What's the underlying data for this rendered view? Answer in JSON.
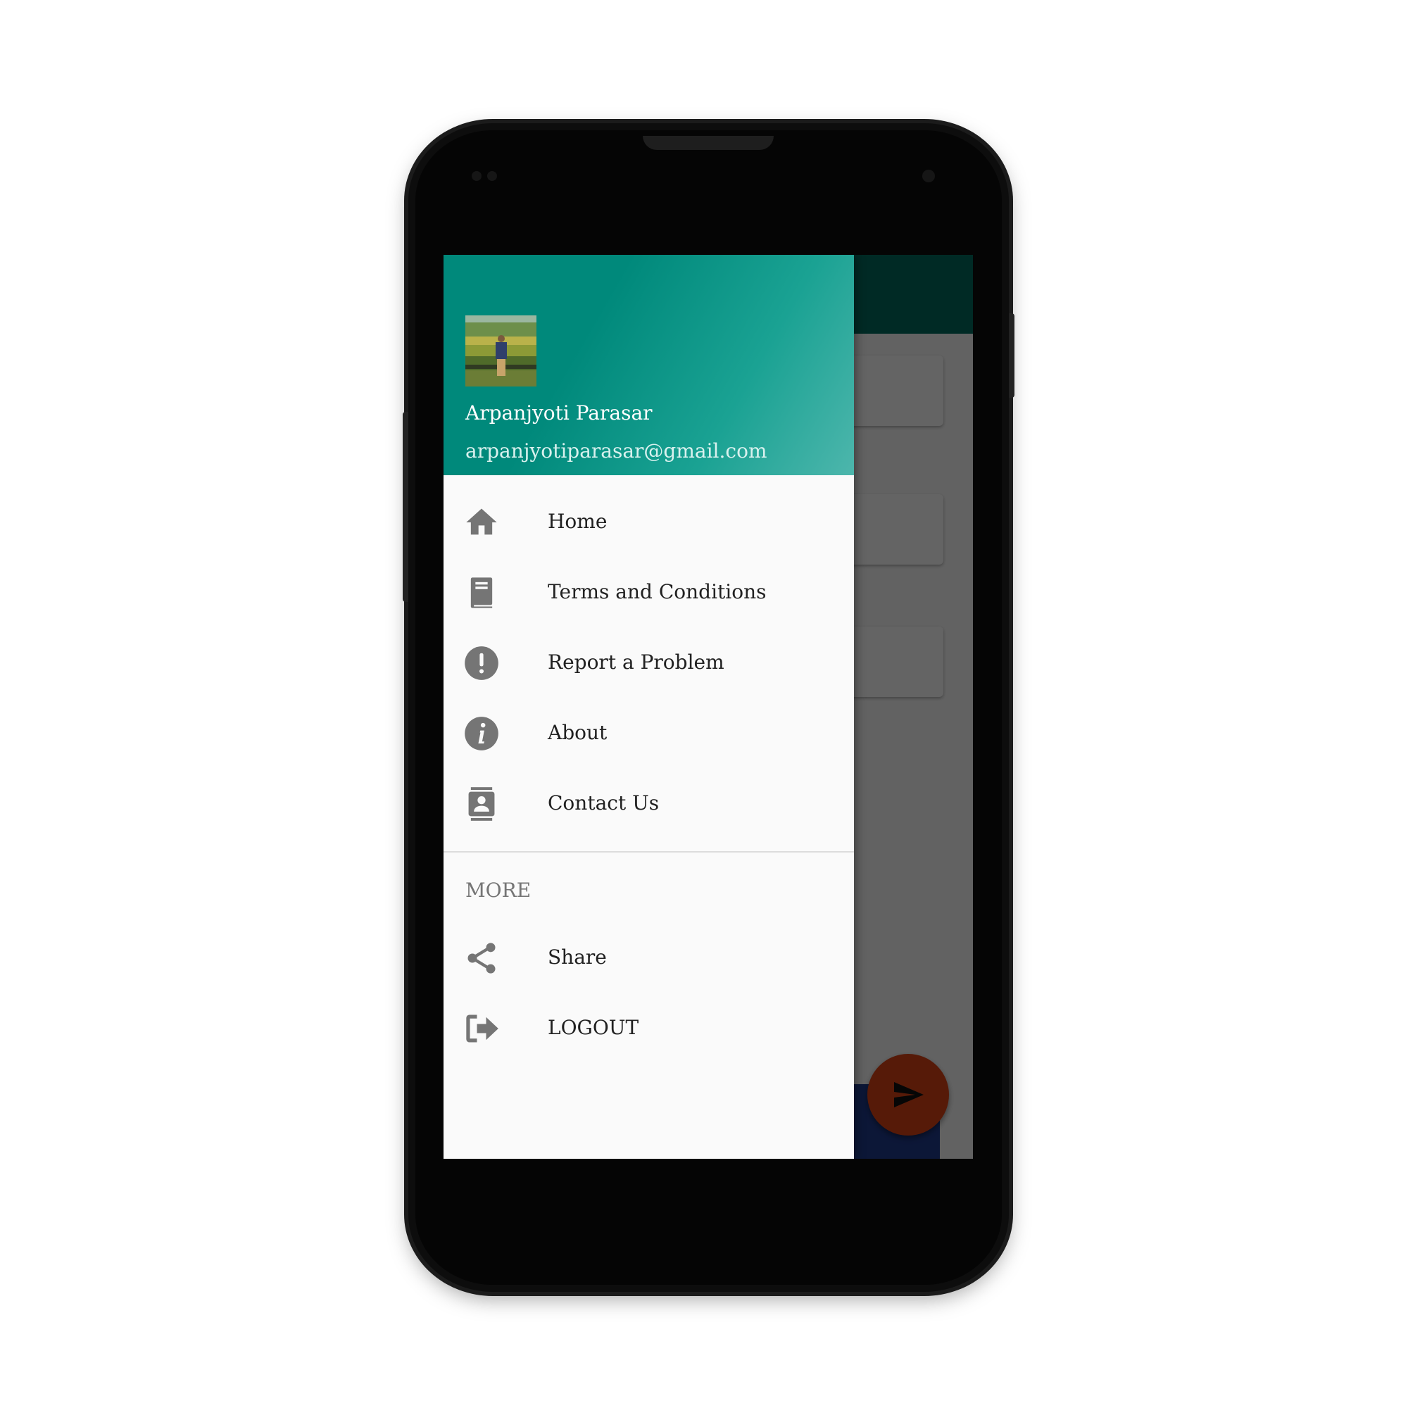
{
  "user": {
    "name": "Arpanjyoti Parasar",
    "email": "arpanjyotiparasar@gmail.com"
  },
  "menu": [
    {
      "label": "Home",
      "icon": "home-icon"
    },
    {
      "label": "Terms and Conditions",
      "icon": "book-icon"
    },
    {
      "label": "Report a Problem",
      "icon": "alert-icon"
    },
    {
      "label": "About",
      "icon": "info-icon"
    },
    {
      "label": "Contact Us",
      "icon": "contacts-icon"
    }
  ],
  "more_section": {
    "title": "MORE",
    "items": [
      {
        "label": "Share",
        "icon": "share-icon"
      },
      {
        "label": "LOGOUT",
        "icon": "logout-icon"
      }
    ]
  },
  "colors": {
    "header_primary": "#00897b",
    "app_bar": "#00695c",
    "fab": "#d84315",
    "icon_gray": "#757575"
  }
}
